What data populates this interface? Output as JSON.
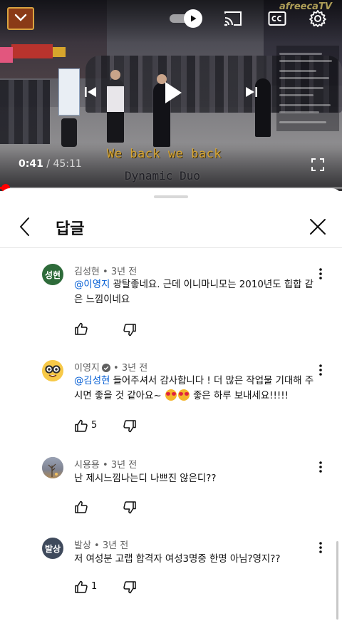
{
  "player": {
    "current_time": "0:41",
    "duration": "45:11",
    "progress_fraction": 0.015,
    "watermark_text": "afreecaTV",
    "lyric_line_1": "We back we back",
    "lyric_line_2": "Dynamic Duo",
    "icons": {
      "collapse": "chevron-down-icon",
      "autoplay": "autoplay-toggle-icon",
      "cast": "cast-icon",
      "captions": "cc-icon",
      "settings": "gear-icon",
      "previous": "skip-previous-icon",
      "play": "play-icon",
      "next": "skip-next-icon",
      "fullscreen": "fullscreen-icon"
    }
  },
  "panel": {
    "title": "답글",
    "back_icon": "chevron-left-icon",
    "close_icon": "close-icon"
  },
  "comments": [
    {
      "avatar_text": "성현",
      "avatar_color": "#2e6b3a",
      "author": "김성현",
      "time": "3년 전",
      "mention": "@이영지",
      "text": " 광탈좋네요. 근데 이니마니모는 2010년도 힙합 같은 느낌이네요",
      "likes": ""
    },
    {
      "avatar_text": "",
      "avatar_color": "#f7c948",
      "author": "이영지",
      "verified": true,
      "time": "3년 전",
      "mention": "@김성현",
      "text_before_emoji": " 들어주셔서 감사합니다 ! 더 많은 작업물 기대해 주시면 좋을 것 같아요~ ",
      "text_after_emoji": " 좋은 하루 보내세요!!!!!",
      "likes": "5"
    },
    {
      "avatar_text": "",
      "avatar_color": "#7d7f88",
      "author": "시용용",
      "time": "3년 전",
      "text": "난 제시느낌나는디 나쁘진 않은디??",
      "likes": ""
    },
    {
      "avatar_text": "발상",
      "avatar_color": "#3f4a5c",
      "author": "발상",
      "time": "3년 전",
      "text": "저 여성분 고랩 합격자 여성3명중 한명 아님?영지??",
      "likes": "1"
    }
  ],
  "separator": " • ",
  "colors": {
    "accent_red": "#ff0000",
    "mention_blue": "#065fd4",
    "meta_gray": "#606060"
  }
}
